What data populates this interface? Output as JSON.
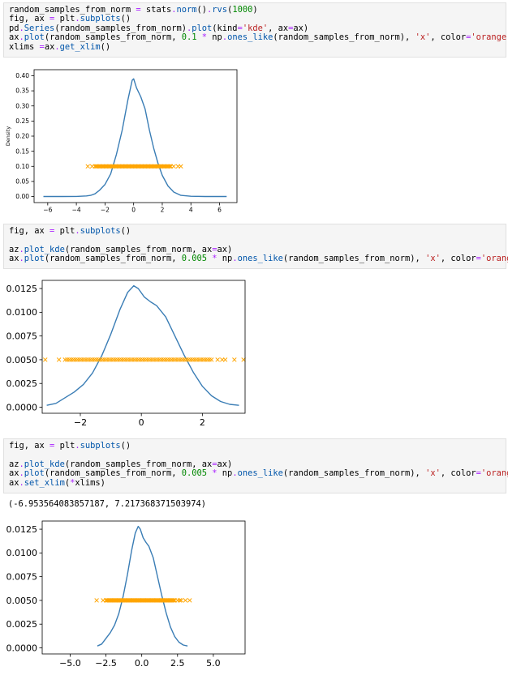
{
  "cells": [
    {
      "lines": [
        [
          {
            "t": "random_samples_from_norm "
          },
          {
            "t": "=",
            "c": "op"
          },
          {
            "t": " stats"
          },
          {
            "t": ".",
            "c": "op"
          },
          {
            "t": "norm",
            "c": "fn"
          },
          {
            "t": "()"
          },
          {
            "t": ".",
            "c": "op"
          },
          {
            "t": "rvs",
            "c": "fn"
          },
          {
            "t": "("
          },
          {
            "t": "1000",
            "c": "num"
          },
          {
            "t": ")"
          }
        ],
        [
          {
            "t": "fig, ax "
          },
          {
            "t": "=",
            "c": "op"
          },
          {
            "t": " plt"
          },
          {
            "t": ".",
            "c": "op"
          },
          {
            "t": "subplots",
            "c": "fn"
          },
          {
            "t": "()"
          }
        ],
        [
          {
            "t": "pd"
          },
          {
            "t": ".",
            "c": "op"
          },
          {
            "t": "Series",
            "c": "fn"
          },
          {
            "t": "(random_samples_from_norm)"
          },
          {
            "t": ".",
            "c": "op"
          },
          {
            "t": "plot",
            "c": "fn"
          },
          {
            "t": "(kind"
          },
          {
            "t": "=",
            "c": "op"
          },
          {
            "t": "'kde'",
            "c": "str"
          },
          {
            "t": ", ax"
          },
          {
            "t": "=",
            "c": "op"
          },
          {
            "t": "ax)"
          }
        ],
        [
          {
            "t": "ax"
          },
          {
            "t": ".",
            "c": "op"
          },
          {
            "t": "plot",
            "c": "fn"
          },
          {
            "t": "(random_samples_from_norm, "
          },
          {
            "t": "0.1",
            "c": "num"
          },
          {
            "t": " "
          },
          {
            "t": "*",
            "c": "op"
          },
          {
            "t": " np"
          },
          {
            "t": ".",
            "c": "op"
          },
          {
            "t": "ones_like",
            "c": "fn"
          },
          {
            "t": "(random_samples_from_norm), "
          },
          {
            "t": "'x'",
            "c": "str"
          },
          {
            "t": ", color"
          },
          {
            "t": "=",
            "c": "op"
          },
          {
            "t": "'orange'",
            "c": "str"
          },
          {
            "t": ");"
          }
        ],
        [
          {
            "t": "xlims "
          },
          {
            "t": "=",
            "c": "op"
          },
          {
            "t": "ax"
          },
          {
            "t": ".",
            "c": "op"
          },
          {
            "t": "get_xlim",
            "c": "fn"
          },
          {
            "t": "()"
          }
        ]
      ]
    },
    {
      "lines": [
        [
          {
            "t": "fig, ax "
          },
          {
            "t": "=",
            "c": "op"
          },
          {
            "t": " plt"
          },
          {
            "t": ".",
            "c": "op"
          },
          {
            "t": "subplots",
            "c": "fn"
          },
          {
            "t": "()"
          }
        ],
        [
          {
            "t": ""
          }
        ],
        [
          {
            "t": "az"
          },
          {
            "t": ".",
            "c": "op"
          },
          {
            "t": "plot_kde",
            "c": "fn"
          },
          {
            "t": "(random_samples_from_norm, ax"
          },
          {
            "t": "=",
            "c": "op"
          },
          {
            "t": "ax)"
          }
        ],
        [
          {
            "t": "ax"
          },
          {
            "t": ".",
            "c": "op"
          },
          {
            "t": "plot",
            "c": "fn"
          },
          {
            "t": "(random_samples_from_norm, "
          },
          {
            "t": "0.005",
            "c": "num"
          },
          {
            "t": " "
          },
          {
            "t": "*",
            "c": "op"
          },
          {
            "t": " np"
          },
          {
            "t": ".",
            "c": "op"
          },
          {
            "t": "ones_like",
            "c": "fn"
          },
          {
            "t": "(random_samples_from_norm), "
          },
          {
            "t": "'x'",
            "c": "str"
          },
          {
            "t": ", color"
          },
          {
            "t": "=",
            "c": "op"
          },
          {
            "t": "'orange'",
            "c": "str"
          },
          {
            "t": ");"
          }
        ]
      ]
    },
    {
      "lines": [
        [
          {
            "t": "fig, ax "
          },
          {
            "t": "=",
            "c": "op"
          },
          {
            "t": " plt"
          },
          {
            "t": ".",
            "c": "op"
          },
          {
            "t": "subplots",
            "c": "fn"
          },
          {
            "t": "()"
          }
        ],
        [
          {
            "t": ""
          }
        ],
        [
          {
            "t": "az"
          },
          {
            "t": ".",
            "c": "op"
          },
          {
            "t": "plot_kde",
            "c": "fn"
          },
          {
            "t": "(random_samples_from_norm, ax"
          },
          {
            "t": "=",
            "c": "op"
          },
          {
            "t": "ax)"
          }
        ],
        [
          {
            "t": "ax"
          },
          {
            "t": ".",
            "c": "op"
          },
          {
            "t": "plot",
            "c": "fn"
          },
          {
            "t": "(random_samples_from_norm, "
          },
          {
            "t": "0.005",
            "c": "num"
          },
          {
            "t": " "
          },
          {
            "t": "*",
            "c": "op"
          },
          {
            "t": " np"
          },
          {
            "t": ".",
            "c": "op"
          },
          {
            "t": "ones_like",
            "c": "fn"
          },
          {
            "t": "(random_samples_from_norm), "
          },
          {
            "t": "'x'",
            "c": "str"
          },
          {
            "t": ", color"
          },
          {
            "t": "=",
            "c": "op"
          },
          {
            "t": "'orange'",
            "c": "str"
          },
          {
            "t": ");"
          }
        ],
        [
          {
            "t": "ax"
          },
          {
            "t": ".",
            "c": "op"
          },
          {
            "t": "set_xlim",
            "c": "fn"
          },
          {
            "t": "("
          },
          {
            "t": "*",
            "c": "op"
          },
          {
            "t": "xlims)"
          }
        ]
      ]
    }
  ],
  "output_text": "(-6.953564083857187, 7.217368371503974)",
  "colors": {
    "kde_line": "#3a7db5",
    "markers": "#ffa500"
  },
  "chart_data": [
    {
      "type": "line",
      "ylabel": "Density",
      "xlim": [
        -6.953564083857187,
        7.217368371503974
      ],
      "ylim": [
        -0.02,
        0.42
      ],
      "xticks": [
        -6,
        -4,
        -2,
        0,
        2,
        4,
        6
      ],
      "xtick_labels": [
        "−6",
        "−4",
        "−2",
        "0",
        "2",
        "4",
        "6"
      ],
      "yticks": [
        0.0,
        0.05,
        0.1,
        0.15,
        0.2,
        0.25,
        0.3,
        0.35,
        0.4
      ],
      "ytick_labels": [
        "0.00",
        "0.05",
        "0.10",
        "0.15",
        "0.20",
        "0.25",
        "0.30",
        "0.35",
        "0.40"
      ],
      "series": [
        {
          "kind": "line",
          "x": [
            -6.3,
            -5,
            -4,
            -3.3,
            -3,
            -2.7,
            -2.4,
            -2,
            -1.6,
            -1.2,
            -0.8,
            -0.4,
            -0.1,
            0,
            0.2,
            0.5,
            0.8,
            1.1,
            1.4,
            1.7,
            2,
            2.4,
            2.8,
            3.3,
            4,
            5,
            6.5
          ],
          "y": [
            0,
            0,
            0.0005,
            0.002,
            0.004,
            0.009,
            0.02,
            0.04,
            0.075,
            0.14,
            0.22,
            0.32,
            0.385,
            0.39,
            0.36,
            0.33,
            0.29,
            0.22,
            0.16,
            0.11,
            0.07,
            0.035,
            0.015,
            0.004,
            0.001,
            0,
            0
          ]
        },
        {
          "kind": "marker",
          "y": 0.1,
          "x_min": -2.7,
          "x_max": 2.6,
          "outliers": [
            -3.2,
            -2.9,
            2.8,
            3.1,
            3.3
          ]
        }
      ]
    },
    {
      "type": "line",
      "xlim": [
        -3.25,
        3.4
      ],
      "ylim": [
        -0.00064,
        0.01336
      ],
      "xticks": [
        -2,
        0,
        2
      ],
      "xtick_labels": [
        "−2",
        "0",
        "2"
      ],
      "yticks": [
        0,
        0.0025,
        0.005,
        0.0075,
        0.01,
        0.0125
      ],
      "ytick_labels": [
        "0.0000",
        "0.0025",
        "0.0050",
        "0.0075",
        "0.0100",
        "0.0125"
      ],
      "series": [
        {
          "kind": "line",
          "x": [
            -3.1,
            -2.8,
            -2.5,
            -2.2,
            -1.9,
            -1.6,
            -1.3,
            -1.0,
            -0.7,
            -0.45,
            -0.25,
            -0.1,
            0.1,
            0.3,
            0.5,
            0.8,
            1.1,
            1.4,
            1.7,
            2.0,
            2.3,
            2.6,
            2.9,
            3.2
          ],
          "y": [
            0.0002,
            0.0004,
            0.001,
            0.0016,
            0.0024,
            0.0036,
            0.0054,
            0.0077,
            0.0103,
            0.0121,
            0.0128,
            0.0125,
            0.0116,
            0.0111,
            0.0107,
            0.0095,
            0.0075,
            0.0055,
            0.0037,
            0.0022,
            0.0012,
            0.0006,
            0.0003,
            0.0002
          ]
        },
        {
          "kind": "marker",
          "y": 0.005,
          "x_min": -2.5,
          "x_max": 2.3,
          "outliers": [
            -3.15,
            -2.7,
            2.5,
            2.65,
            2.75,
            3.05,
            3.35
          ]
        }
      ]
    },
    {
      "type": "line",
      "xlim": [
        -6.953564083857187,
        7.217368371503974
      ],
      "ylim": [
        -0.00064,
        0.01336
      ],
      "xticks": [
        -5,
        -2.5,
        0,
        2.5,
        5
      ],
      "xtick_labels": [
        "−5.0",
        "−2.5",
        "0.0",
        "2.5",
        "5.0"
      ],
      "yticks": [
        0,
        0.0025,
        0.005,
        0.0075,
        0.01,
        0.0125
      ],
      "ytick_labels": [
        "0.0000",
        "0.0025",
        "0.0050",
        "0.0075",
        "0.0100",
        "0.0125"
      ],
      "series": [
        {
          "kind": "line",
          "x": [
            -3.1,
            -2.8,
            -2.5,
            -2.2,
            -1.9,
            -1.6,
            -1.3,
            -1.0,
            -0.7,
            -0.45,
            -0.25,
            -0.1,
            0.1,
            0.3,
            0.5,
            0.8,
            1.1,
            1.4,
            1.7,
            2.0,
            2.3,
            2.6,
            2.9,
            3.2
          ],
          "y": [
            0.0002,
            0.0004,
            0.001,
            0.0016,
            0.0024,
            0.0036,
            0.0054,
            0.0077,
            0.0103,
            0.0121,
            0.0128,
            0.0125,
            0.0116,
            0.0111,
            0.0107,
            0.0095,
            0.0075,
            0.0055,
            0.0037,
            0.0022,
            0.0012,
            0.0006,
            0.0003,
            0.0002
          ]
        },
        {
          "kind": "marker",
          "y": 0.005,
          "x_min": -2.5,
          "x_max": 2.3,
          "outliers": [
            -3.15,
            -2.7,
            2.5,
            2.65,
            2.75,
            3.05,
            3.35
          ]
        }
      ]
    }
  ]
}
